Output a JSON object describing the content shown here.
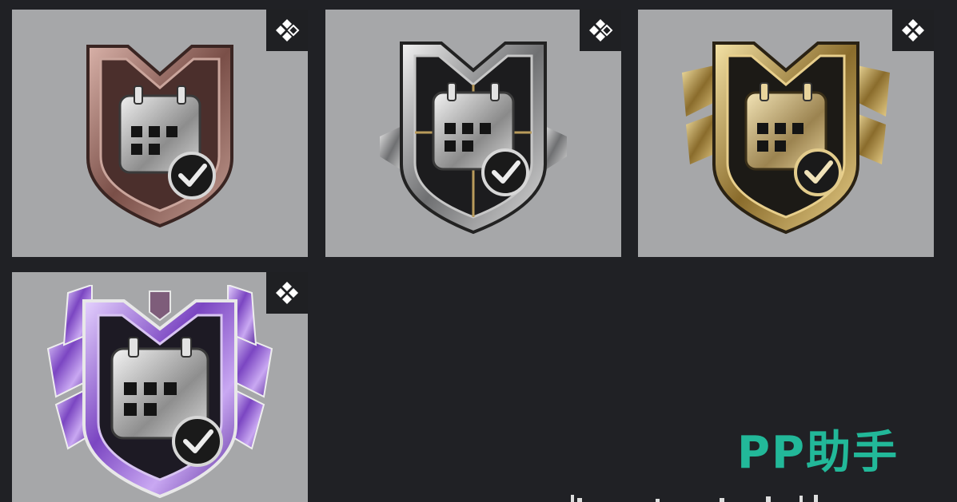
{
  "badges": [
    {
      "tier": "bronze",
      "tag_icon": "diamond-cluster-icon",
      "tone": "#8c6a64"
    },
    {
      "tier": "silver",
      "tag_icon": "diamond-cluster-icon",
      "tone": "#b7b8ba"
    },
    {
      "tier": "gold",
      "tag_icon": "diamond-cluster-icon",
      "tone": "#c8ad6a"
    },
    {
      "tier": "purple",
      "tag_icon": "diamond-cluster-icon",
      "tone": "#8f62c9"
    }
  ],
  "watermark": {
    "text": "PP助手",
    "color": "#22b899"
  },
  "colors": {
    "background": "#202125",
    "card": "#a6a7a9",
    "tag": "#1f2023"
  }
}
